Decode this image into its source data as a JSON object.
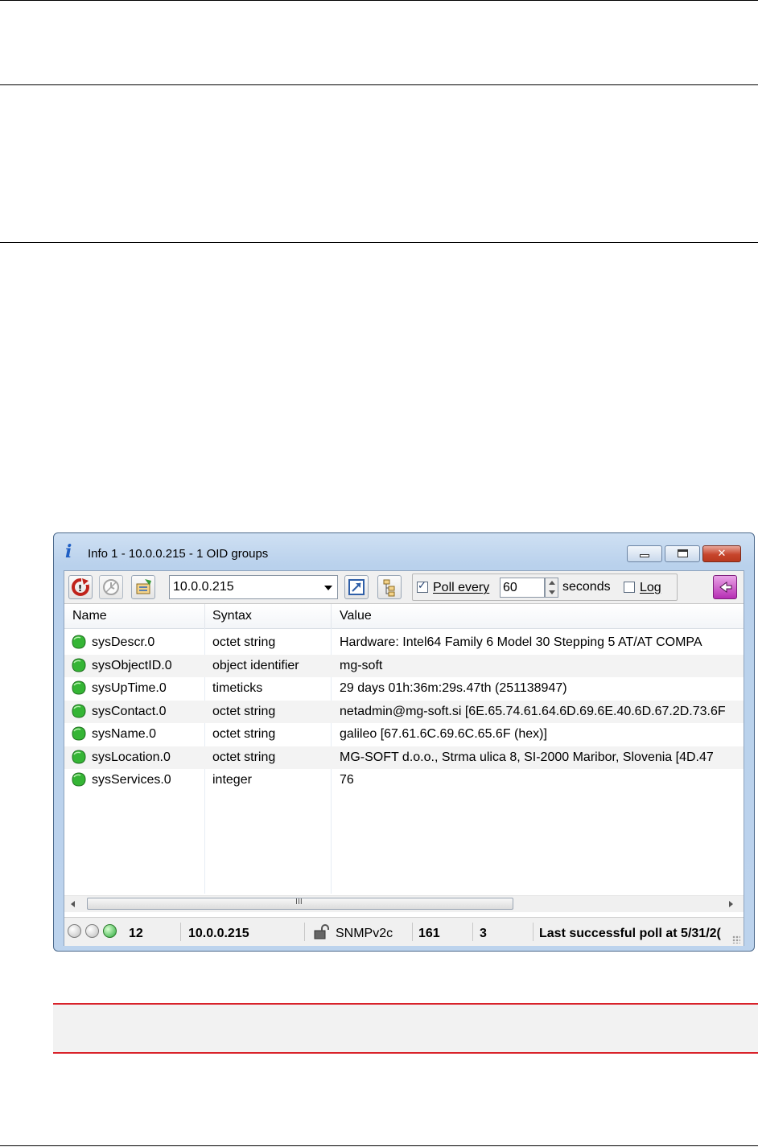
{
  "window": {
    "title": "Info 1  -  10.0.0.215  -  1 OID groups",
    "title_icon": "info-icon"
  },
  "toolbar": {
    "host_value": "10.0.0.215",
    "poll_label": "Poll every",
    "poll_checked": true,
    "poll_interval": "60",
    "seconds_label": "seconds",
    "log_label": "Log",
    "log_checked": false
  },
  "list": {
    "columns": [
      "Name",
      "Syntax",
      "Value"
    ],
    "rows": [
      {
        "name": "sysDescr.0",
        "syntax": "octet string",
        "value": "Hardware: Intel64 Family 6 Model 30 Stepping 5 AT/AT COMPA"
      },
      {
        "name": "sysObjectID.0",
        "syntax": "object identifier",
        "value": "mg-soft"
      },
      {
        "name": "sysUpTime.0",
        "syntax": "timeticks",
        "value": "29 days 01h:36m:29s.47th (251138947)"
      },
      {
        "name": "sysContact.0",
        "syntax": "octet string",
        "value": "netadmin@mg-soft.si [6E.65.74.61.64.6D.69.6E.40.6D.67.2D.73.6F"
      },
      {
        "name": "sysName.0",
        "syntax": "octet string",
        "value": "galileo [67.61.6C.69.6C.65.6F (hex)]"
      },
      {
        "name": "sysLocation.0",
        "syntax": "octet string",
        "value": "MG-SOFT d.o.o., Strma ulica 8, SI-2000 Maribor, Slovenia [4D.47"
      },
      {
        "name": "sysServices.0",
        "syntax": "integer",
        "value": "76"
      }
    ]
  },
  "scrollbar": {
    "grip": "III"
  },
  "status": {
    "count": "12",
    "host": "10.0.0.215",
    "protocol": "SNMPv2c",
    "port": "161",
    "retries": "3",
    "message": "Last successful poll at 5/31/2("
  }
}
